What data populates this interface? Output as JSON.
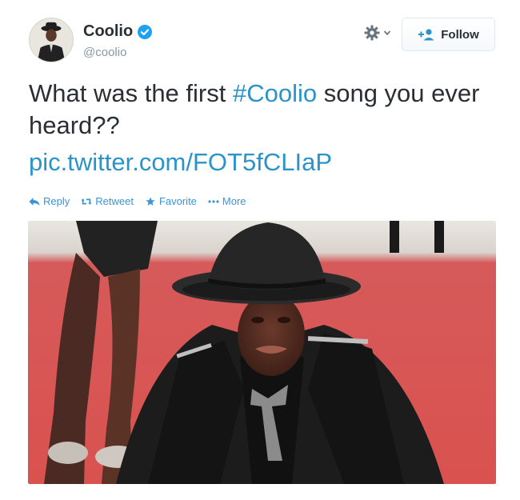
{
  "user": {
    "display_name": "Coolio",
    "handle": "@coolio",
    "verified_icon": "verified-badge-icon",
    "avatar_icon": "avatar"
  },
  "header": {
    "gear_icon": "gear-icon",
    "follow_label": "Follow"
  },
  "tweet": {
    "text_before": "What was the first ",
    "hashtag": "#Coolio",
    "text_after": " song you ever heard??",
    "link": "pic.twitter.com/FOT5fCLIaP"
  },
  "actions": {
    "reply": "Reply",
    "retweet": "Retweet",
    "favorite": "Favorite",
    "more": "More"
  },
  "colors": {
    "link": "#2a94c9",
    "action": "#3b94d9",
    "verified": "#1da1f2",
    "text": "#292f33",
    "muted": "#8899a6"
  }
}
